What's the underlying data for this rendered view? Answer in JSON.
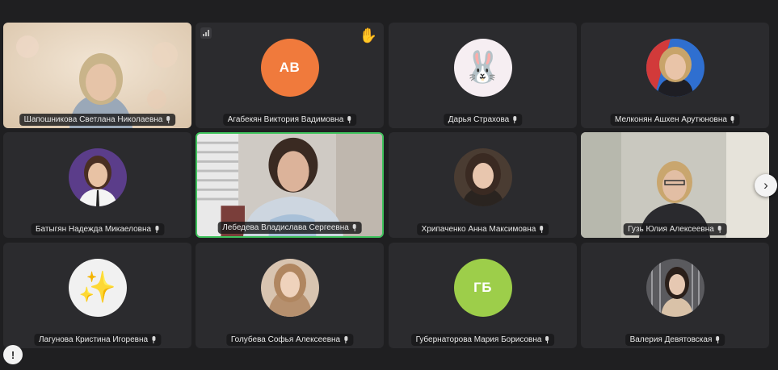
{
  "participants": [
    {
      "name": "Шапошникова Светлана Николаевна",
      "type": "video"
    },
    {
      "name": "Агабекян Виктория Вадимовна",
      "type": "initials",
      "initials": "АВ",
      "avatar_color": "#f07a3c",
      "hand_raised": true
    },
    {
      "name": "Дарья Страхова",
      "type": "emoji-avatar",
      "avatar_icon": "rabbit-icon",
      "avatar_glyph": "🐰",
      "avatar_color": "#f6eef2"
    },
    {
      "name": "Мелконян Ашхен Арутюновна",
      "type": "photo-avatar",
      "avatar_color": "#7a4a35"
    },
    {
      "name": "Батыгян Надежда Микаеловна",
      "type": "photo-avatar",
      "avatar_color": "#5b3d8a"
    },
    {
      "name": "Лебедева Владислава Сергеевна",
      "type": "video",
      "speaking": true
    },
    {
      "name": "Хрипаченко Анна Максимовна",
      "type": "photo-avatar",
      "avatar_color": "#5a4a3c"
    },
    {
      "name": "Гузь Юлия Алексеевна",
      "type": "video"
    },
    {
      "name": "Лагунова Кристина Игоревна",
      "type": "emoji-avatar",
      "avatar_icon": "sparkles-icon",
      "avatar_glyph": "✨",
      "avatar_color": "#f1f1f1"
    },
    {
      "name": "Голубева Софья Алексеевна",
      "type": "photo-avatar",
      "avatar_color": "#b6906e"
    },
    {
      "name": "Губернаторова Мария Борисовна",
      "type": "initials",
      "initials": "ГБ",
      "avatar_color": "#9dce4a"
    },
    {
      "name": "Валерия Девятовская",
      "type": "photo-avatar",
      "avatar_color": "#6e6e6e"
    }
  ],
  "controls": {
    "next_page_glyph": "›",
    "report_glyph": "!"
  },
  "colors": {
    "background": "#1f1f21",
    "tile": "#2b2b2e",
    "speaking_border": "#3fc35d"
  }
}
